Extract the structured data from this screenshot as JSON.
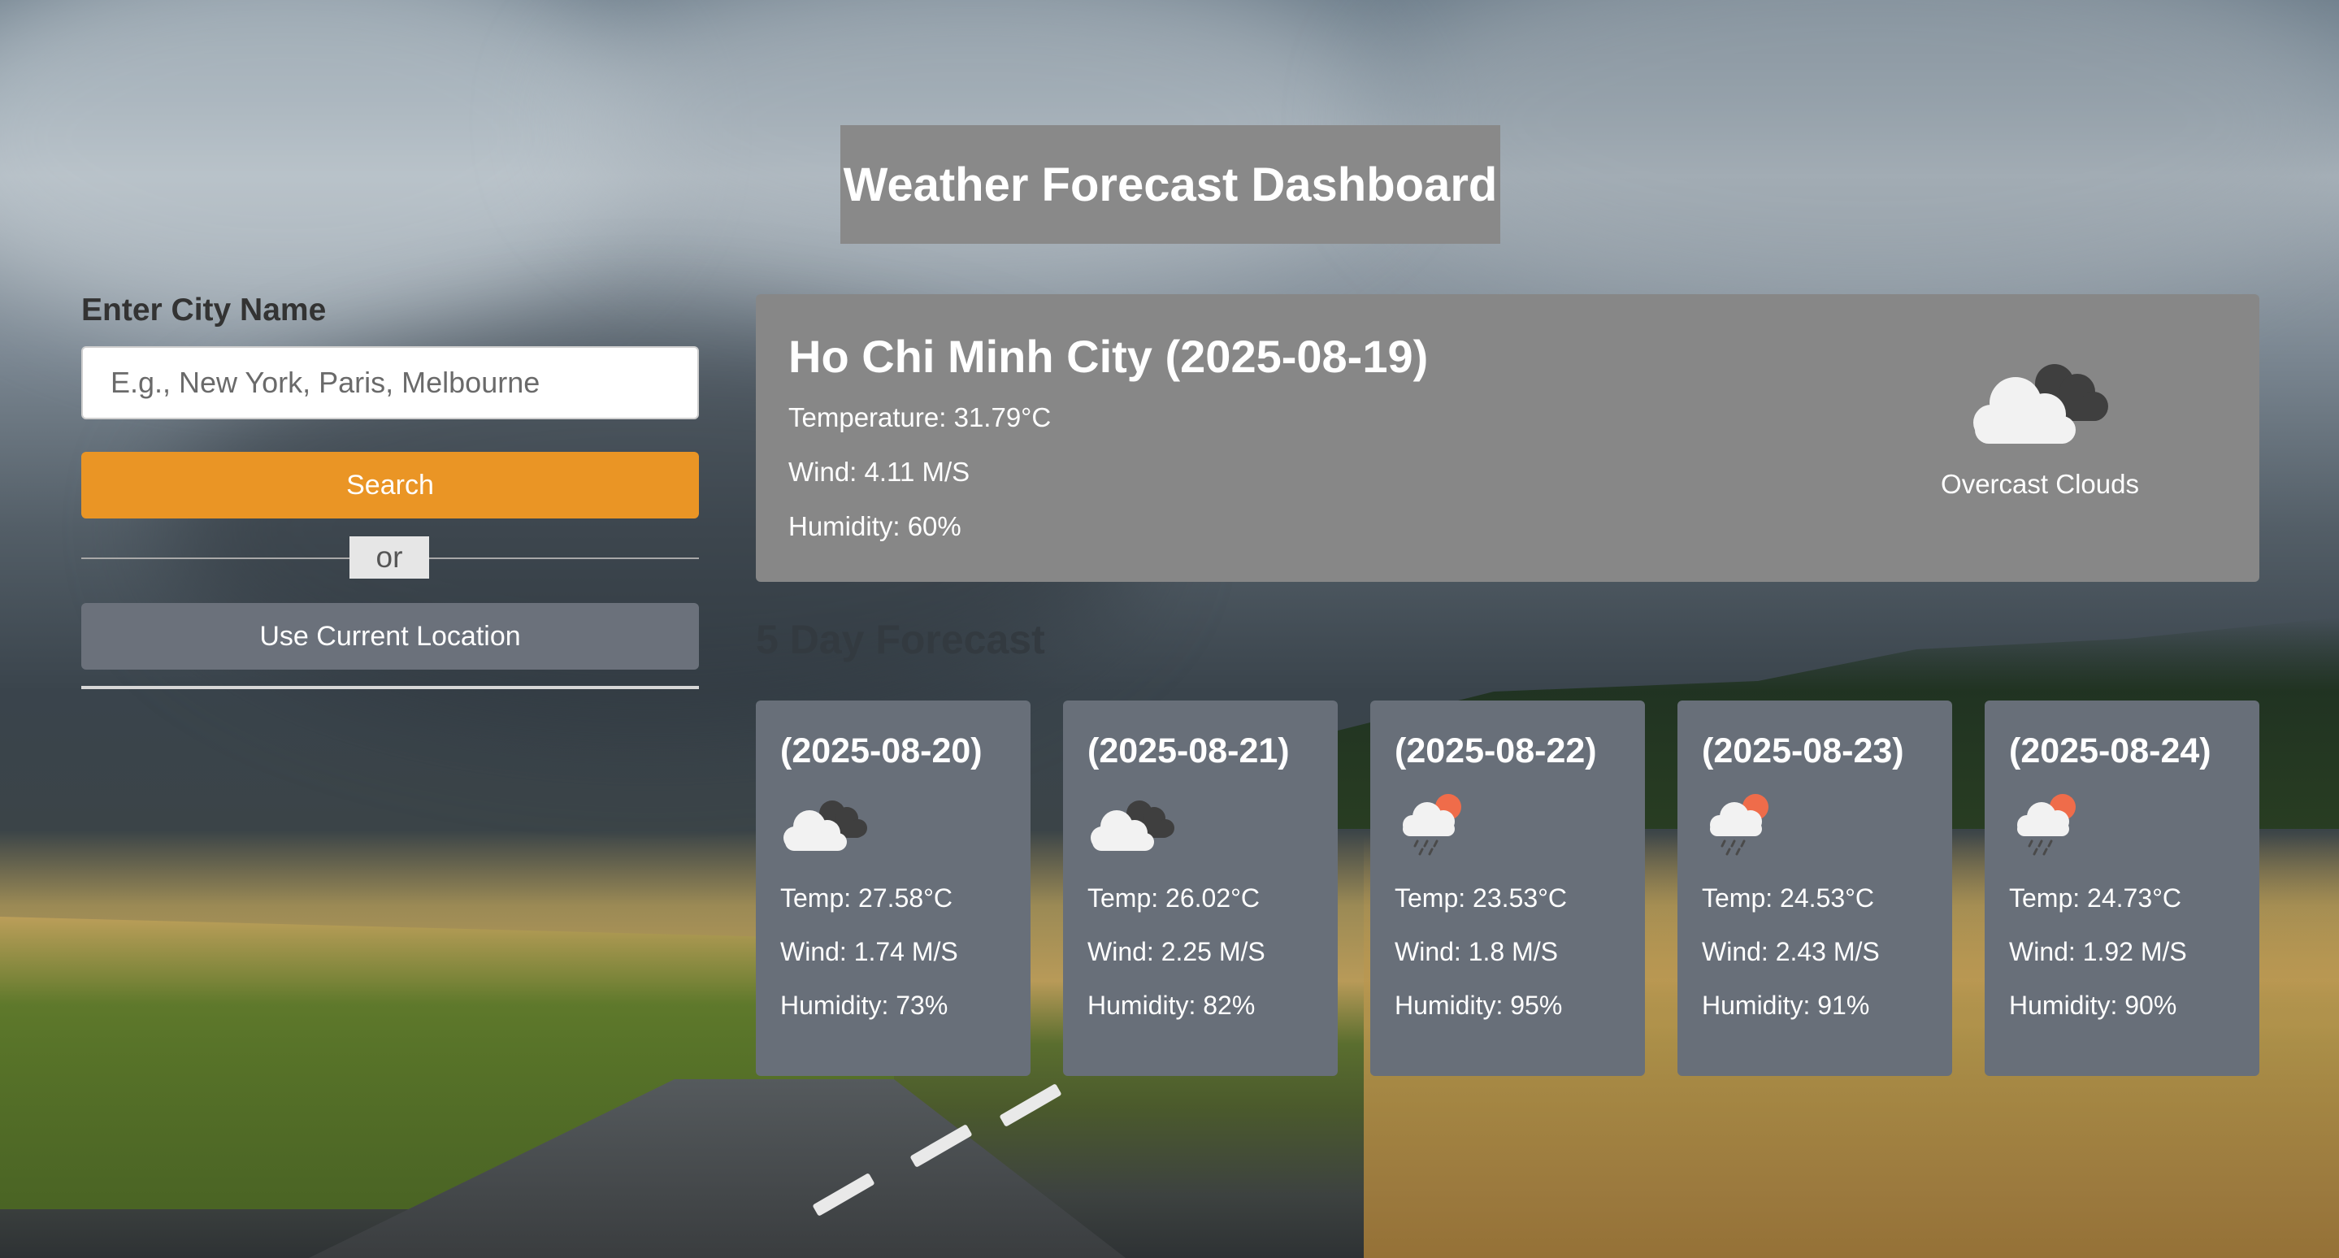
{
  "app": {
    "title": "Weather Forecast Dashboard"
  },
  "sidebar": {
    "city_label": "Enter City Name",
    "city_placeholder": "E.g., New York, Paris, Melbourne",
    "city_value": "",
    "search_label": "Search",
    "or_label": "or",
    "location_label": "Use Current Location"
  },
  "current": {
    "heading": "Ho Chi Minh City (2025-08-19)",
    "temperature": "Temperature: 31.79°C",
    "wind": "Wind: 4.11 M/S",
    "humidity": "Humidity: 60%",
    "icon": "overcast-clouds-icon",
    "description": "Overcast Clouds"
  },
  "forecast": {
    "title": "5 Day Forecast",
    "days": [
      {
        "date": "(2025-08-20)",
        "icon": "overcast-clouds-icon",
        "temp": "Temp: 27.58°C",
        "wind": "Wind: 1.74 M/S",
        "humidity": "Humidity: 73%"
      },
      {
        "date": "(2025-08-21)",
        "icon": "overcast-clouds-icon",
        "temp": "Temp: 26.02°C",
        "wind": "Wind: 2.25 M/S",
        "humidity": "Humidity: 82%"
      },
      {
        "date": "(2025-08-22)",
        "icon": "light-rain-icon",
        "temp": "Temp: 23.53°C",
        "wind": "Wind: 1.8 M/S",
        "humidity": "Humidity: 95%"
      },
      {
        "date": "(2025-08-23)",
        "icon": "light-rain-icon",
        "temp": "Temp: 24.53°C",
        "wind": "Wind: 2.43 M/S",
        "humidity": "Humidity: 91%"
      },
      {
        "date": "(2025-08-24)",
        "icon": "light-rain-icon",
        "temp": "Temp: 24.73°C",
        "wind": "Wind: 1.92 M/S",
        "humidity": "Humidity: 90%"
      }
    ]
  },
  "colors": {
    "search_button": "#ea9525",
    "location_button": "#6b717b",
    "panel_gray": "#878787",
    "card_slate": "#686f79"
  }
}
